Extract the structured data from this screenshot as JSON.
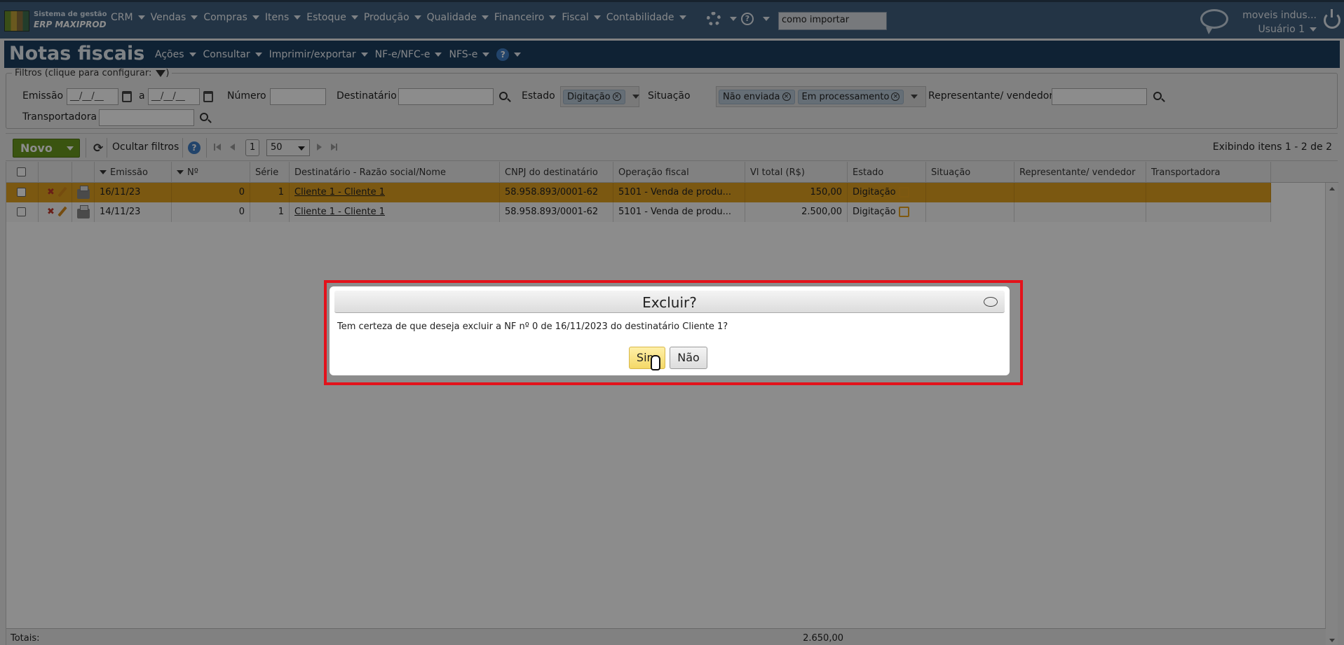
{
  "app": {
    "logo_line1": "Sistema de gestão",
    "logo_line2": "ERP MAXIPROD",
    "menu": [
      "CRM",
      "Vendas",
      "Compras",
      "Itens",
      "Estoque",
      "Produção",
      "Qualidade",
      "Financeiro",
      "Fiscal",
      "Contabilidade"
    ],
    "search_value": "como importar",
    "company": "moveis indus...",
    "user": "Usuário 1"
  },
  "page": {
    "title": "Notas fiscais",
    "submenu": [
      "Ações",
      "Consultar",
      "Imprimir/exportar",
      "NF-e/NFC-e",
      "NFS-e"
    ],
    "help": "?"
  },
  "filters": {
    "legend": "Filtros (clique para configurar:",
    "legend_close": ")",
    "emissao_label": "Emissão",
    "date_from": "__/__/__",
    "date_sep": "a",
    "date_to": "__/__/__",
    "numero_label": "Número",
    "destinatario_label": "Destinatário",
    "estado_label": "Estado",
    "estado_chips": [
      "Digitação"
    ],
    "situacao_label": "Situação",
    "situacao_chips": [
      "Não enviada",
      "Em processamento"
    ],
    "representante_label": "Representante/ vendedor",
    "transportadora_label": "Transportadora"
  },
  "toolbar": {
    "novo": "Novo",
    "hide_filters": "Ocultar filtros",
    "page": "1",
    "page_size": "50",
    "showing": "Exibindo itens 1 - 2 de 2"
  },
  "grid": {
    "columns": {
      "emissao": "Emissão",
      "numero": "Nº",
      "serie": "Série",
      "destinatario": "Destinatário - Razão social/Nome",
      "cnpj": "CNPJ do destinatário",
      "operacao": "Operação fiscal",
      "vl_total": "Vl total (R$)",
      "estado": "Estado",
      "situacao": "Situação",
      "representante": "Representante/ vendedor",
      "transportadora": "Transportadora"
    },
    "rows": [
      {
        "emissao": "16/11/23",
        "numero": "0",
        "serie": "1",
        "destinatario": "Cliente 1 - Cliente 1",
        "cnpj": "58.958.893/0001-62",
        "operacao": "5101 - Venda de produ...",
        "vl_total": "150,00",
        "estado": "Digitação"
      },
      {
        "emissao": "14/11/23",
        "numero": "0",
        "serie": "1",
        "destinatario": "Cliente 1 - Cliente 1",
        "cnpj": "58.958.893/0001-62",
        "operacao": "5101 - Venda de produ...",
        "vl_total": "2.500,00",
        "estado": "Digitação"
      }
    ],
    "totals_label": "Totais:",
    "totals_value": "2.650,00"
  },
  "dialog": {
    "title": "Excluir?",
    "message": "Tem certeza de que deseja excluir a NF nº 0 de 16/11/2023 do destinatário Cliente 1?",
    "yes": "Sim",
    "no": "Não"
  },
  "colors": {
    "topbar": "#40607f",
    "titlebar": "#1d3e5f",
    "selected_row": "#e0a020",
    "novo_button": "#6b9a1e",
    "highlight": "#e3121b"
  }
}
